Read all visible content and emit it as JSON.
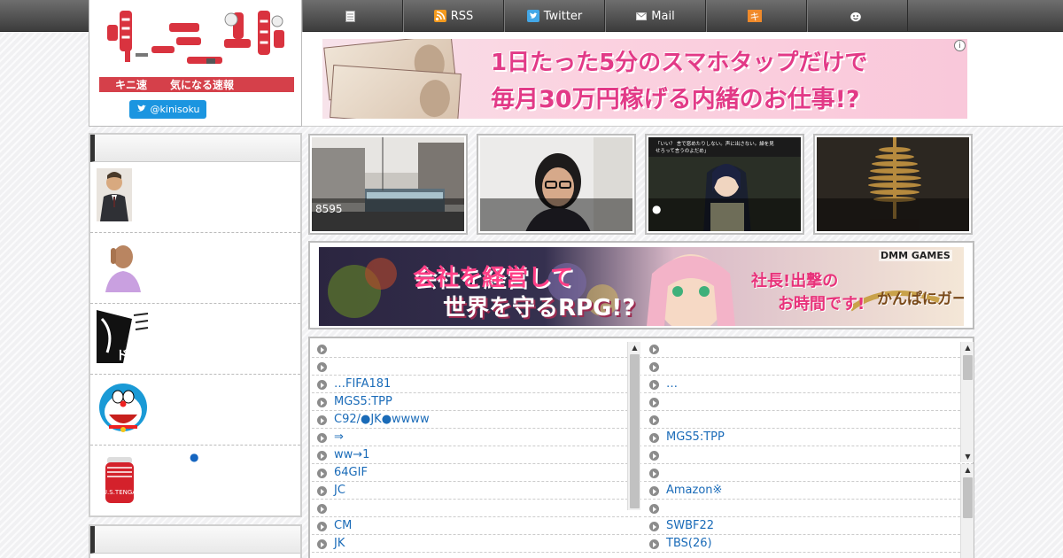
{
  "nav": {
    "items": [
      {
        "label": "",
        "icon": "document-icon"
      },
      {
        "label": "RSS",
        "icon": "rss-icon"
      },
      {
        "label": "Twitter",
        "icon": "twitter-icon"
      },
      {
        "label": "Mail",
        "icon": "mail-icon"
      },
      {
        "label": "",
        "icon": "kinisoku-mark-icon"
      },
      {
        "label": "",
        "icon": "face-icon"
      }
    ]
  },
  "logo": {
    "name": "キニ速",
    "tagline": "気になる速報",
    "twitter_handle": "@kinisoku"
  },
  "ad_top": {
    "line1": "1日たった5分のスマホタップだけで",
    "line2": "毎月30万円稼げる内緒のお仕事!?",
    "info": "i"
  },
  "sidebar": {
    "ranking": [
      {
        "text": "",
        "thumb": "man-in-suit"
      },
      {
        "text": "",
        "thumb": "man-thinking"
      },
      {
        "text": "",
        "thumb": "manga-panel"
      },
      {
        "text": "",
        "thumb": "doraemon"
      },
      {
        "text": "●",
        "thumb": "tenga-cup"
      }
    ]
  },
  "features": [
    {
      "caption": "8595",
      "image": "tram-station"
    },
    {
      "caption": "",
      "image": "woman-glasses"
    },
    {
      "caption": "●",
      "image": "anime-game-scene"
    },
    {
      "caption": "",
      "image": "golden-machine"
    }
  ],
  "ad_mid": {
    "brand": "DMM GAMES",
    "line1": "会社を経営して",
    "line2": "世界を守るRPG!?",
    "line3": "社長!出撃の",
    "line4": "お時間です!",
    "logo": "かんぱにガールズ"
  },
  "list_left": [
    "",
    "",
    "…FIFA181",
    "MGS5:TPP",
    "C92/●JK●wwww",
    " ⇒",
    "ww→1",
    "64GIF",
    "JC",
    "",
    "CM",
    "JK"
  ],
  "list_right": [
    "",
    "",
    "…",
    "",
    "",
    "MGS5:TPP",
    "",
    "",
    "Amazon※",
    "",
    "SWBF22",
    "TBS(26)"
  ],
  "colors": {
    "nav_bg": "#4a4a4a",
    "brand_red": "#d5404a",
    "twitter_blue": "#1b95e0",
    "link": "#1a6bb8",
    "ad_pink": "#e23a87"
  }
}
